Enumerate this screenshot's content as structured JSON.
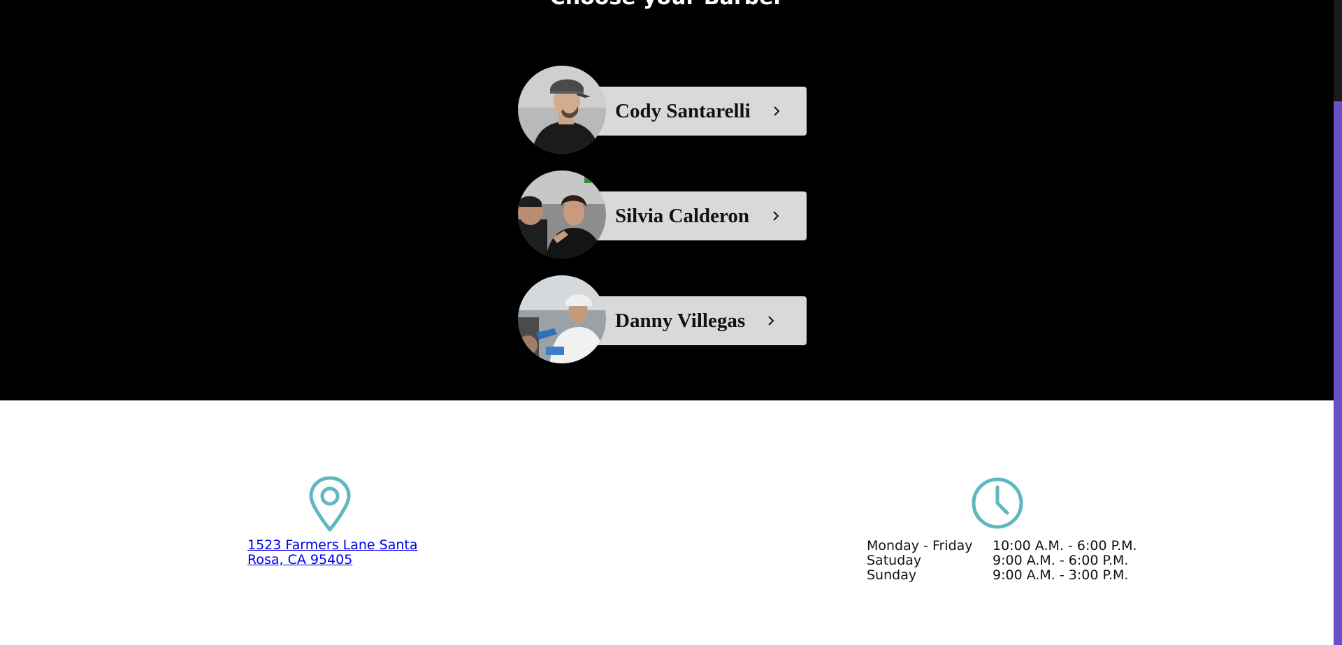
{
  "barbers_section": {
    "title": "Choose your Barber",
    "barbers": [
      {
        "name": "Cody Santarelli"
      },
      {
        "name": "Silvia Calderon"
      },
      {
        "name": "Danny Villegas"
      }
    ]
  },
  "location": {
    "address": "1523 Farmers Lane Santa Rosa, CA 95405",
    "icon": "location-pin-icon"
  },
  "hours": {
    "icon": "clock-icon",
    "rows": [
      {
        "day": "Monday - Friday",
        "time": "10:00 A.M. - 6:00 P.M."
      },
      {
        "day": "Satuday",
        "time": "9:00 A.M. - 6:00 P.M."
      },
      {
        "day": "Sunday",
        "time": "9:00 A.M. - 3:00 P.M."
      }
    ]
  },
  "colors": {
    "accent": "#5fb8bf",
    "dark_background": "#000000",
    "button_background": "#d9d9d9",
    "scrollbar_thumb": "#6a4fc9",
    "link": "#0000ee"
  }
}
